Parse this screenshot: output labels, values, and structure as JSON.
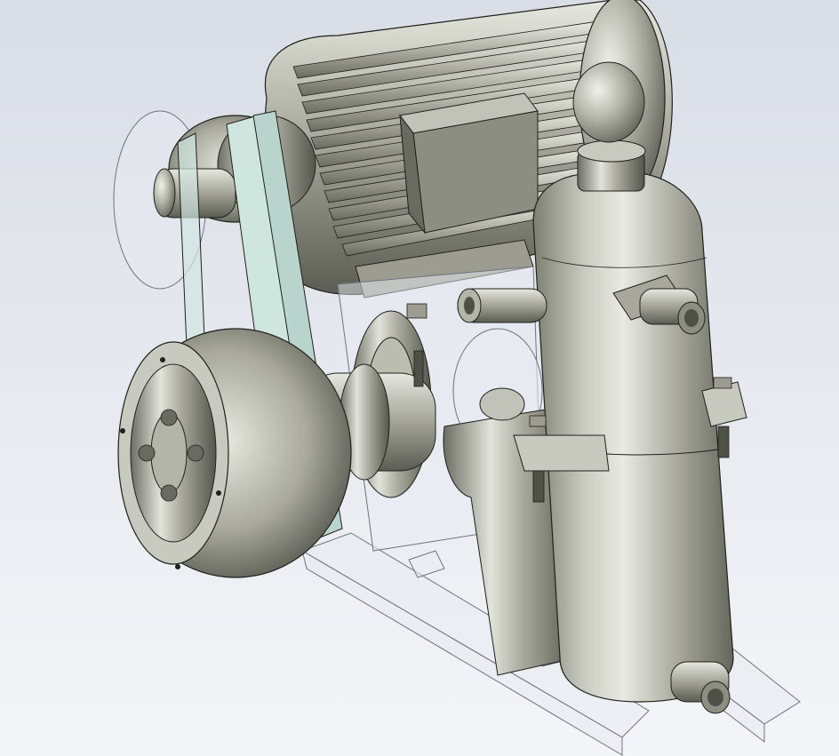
{
  "viewport": {
    "background_top": "#d9dde6",
    "background_bottom": "#f4f5f8"
  },
  "colors": {
    "metal_dark": "#4f5046",
    "metal_mid": "#9a9b8e",
    "metal_light": "#e4e5dc",
    "edge": "#1f201c",
    "belt": "#cfe6df",
    "transparent_part": "#e8ebf2",
    "fin_shadow": "#6f7065"
  },
  "icons": {
    "motor": "motor-icon",
    "pulley": "pulley-icon",
    "belt": "belt-icon",
    "tank": "tank-icon",
    "rail": "rail-icon",
    "bearing": "bearing-icon",
    "bolt": "bolt-icon"
  }
}
